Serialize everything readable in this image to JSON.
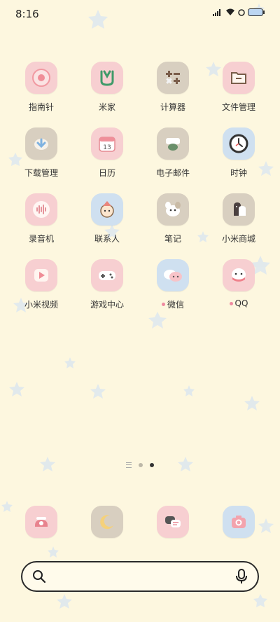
{
  "status_bar": {
    "time": "8:16",
    "icons": [
      "signal-icon",
      "wifi-icon",
      "alarm-icon",
      "battery-icon"
    ]
  },
  "apps": [
    {
      "label": "指南针",
      "icon": "compass-icon",
      "color": "pink",
      "notify": false
    },
    {
      "label": "米家",
      "icon": "mijia-icon",
      "color": "pink",
      "notify": false
    },
    {
      "label": "计算器",
      "icon": "calculator-icon",
      "color": "beige",
      "notify": false
    },
    {
      "label": "文件管理",
      "icon": "folder-icon",
      "color": "pink",
      "notify": false
    },
    {
      "label": "下载管理",
      "icon": "download-icon",
      "color": "beige",
      "notify": false
    },
    {
      "label": "日历",
      "icon": "calendar-icon",
      "color": "pink",
      "notify": false,
      "day": "13"
    },
    {
      "label": "电子邮件",
      "icon": "mail-icon",
      "color": "beige",
      "notify": false
    },
    {
      "label": "时钟",
      "icon": "clock-icon",
      "color": "blue",
      "notify": false
    },
    {
      "label": "录音机",
      "icon": "recorder-icon",
      "color": "pink",
      "notify": false
    },
    {
      "label": "联系人",
      "icon": "contacts-icon",
      "color": "blue",
      "notify": false
    },
    {
      "label": "笔记",
      "icon": "notes-icon",
      "color": "beige",
      "notify": false
    },
    {
      "label": "小米商城",
      "icon": "mi-store-icon",
      "color": "beige",
      "notify": false
    },
    {
      "label": "小米视频",
      "icon": "video-icon",
      "color": "pink",
      "notify": false
    },
    {
      "label": "游戏中心",
      "icon": "gamepad-icon",
      "color": "pink",
      "notify": false
    },
    {
      "label": "微信",
      "icon": "wechat-icon",
      "color": "blue",
      "notify": true
    },
    {
      "label": "QQ",
      "icon": "qq-icon",
      "color": "pink",
      "notify": true
    }
  ],
  "page_indicator": {
    "pages": 2,
    "active": 2
  },
  "dock": [
    {
      "icon": "phone-icon",
      "color": "pink"
    },
    {
      "icon": "moon-icon",
      "color": "beige"
    },
    {
      "icon": "messages-icon",
      "color": "pink"
    },
    {
      "icon": "camera-icon",
      "color": "blue"
    }
  ],
  "search": {
    "placeholder": ""
  }
}
